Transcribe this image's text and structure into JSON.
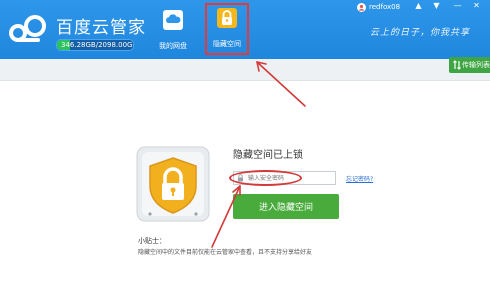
{
  "app": {
    "title": "百度云管家",
    "storage_text": "346.28GB/2098.00GB",
    "storage_used_fraction": 0.165
  },
  "nav": {
    "items": [
      {
        "label": "我的网盘",
        "icon": "cloud-drive-icon"
      },
      {
        "label": "隐藏空间",
        "icon": "lock-icon"
      }
    ]
  },
  "user": {
    "name": "redfox08",
    "icon": "user-icon"
  },
  "window_controls": {
    "pin": "▲",
    "menu": "▼",
    "minimize": "—",
    "close": "✕"
  },
  "slogan": "云上的日子，你我共享",
  "transfer": {
    "label": "传输列表",
    "icon": "transfer-icon"
  },
  "lock_panel": {
    "title": "隐藏空间已上锁",
    "password_placeholder": "输入安全密码",
    "forgot_label": "忘记密码?",
    "enter_label": "进入隐藏空间",
    "tips_title": "小贴士：",
    "tips_text": "隐藏空间中的文件目前仅能在云管家中查看，且不支持分享给好友"
  },
  "colors": {
    "header_blue": "#1f86dd",
    "accent_green": "#49ab3c",
    "annotation_red": "#d33a3a",
    "link_blue": "#2a6fd6"
  }
}
